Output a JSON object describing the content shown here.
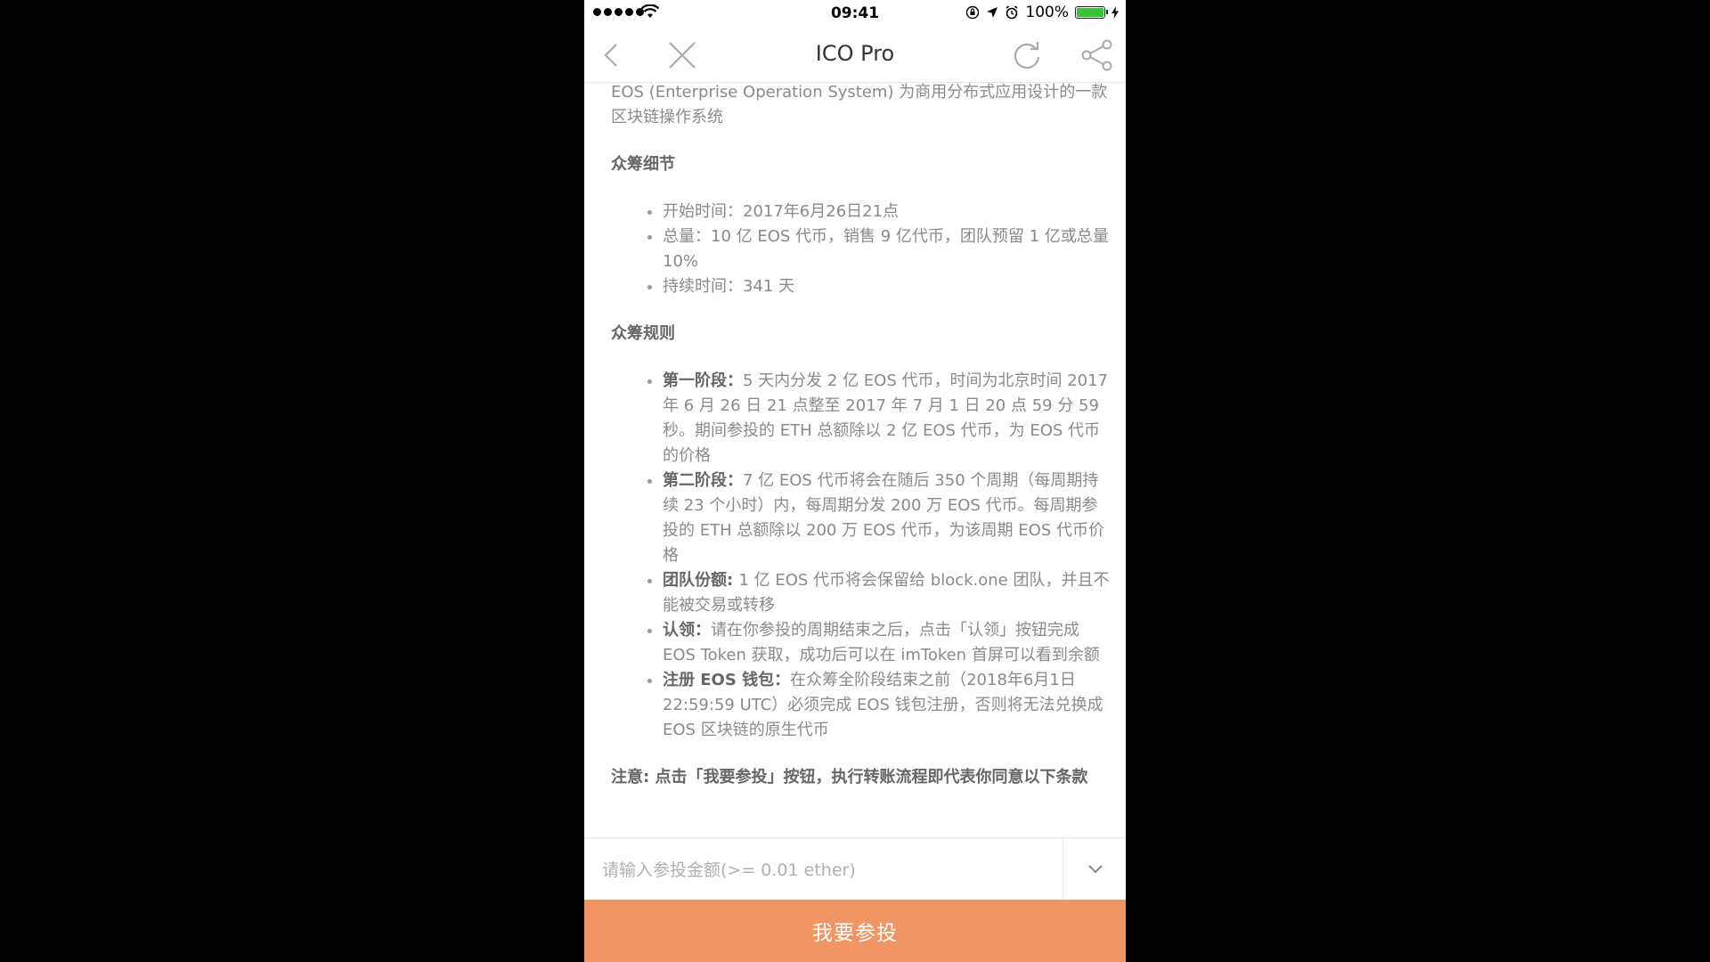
{
  "status_bar": {
    "time": "09:41",
    "battery_percent": "100%",
    "battery_level": 1.0
  },
  "nav": {
    "title": "ICO Pro",
    "icons": [
      "back-icon",
      "close-icon",
      "refresh-icon",
      "share-icon"
    ]
  },
  "content": {
    "intro": "EOS (Enterprise Operation System) 为商用分布式应用设计的一款区块链操作系统",
    "details": {
      "title": "众筹细节",
      "items": [
        "开始时间：2017年6月26日21点",
        "总量：10 亿 EOS 代币，销售 9 亿代币，团队预留 1 亿或总量 10%",
        "持续时间：341 天"
      ]
    },
    "rules": {
      "title": "众筹规则",
      "items": [
        {
          "label": "第一阶段：",
          "text": "5 天内分发 2 亿 EOS 代币，时间为北京时间 2017 年 6 月 26 日 21 点整至 2017 年 7 月 1 日 20 点 59 分 59 秒。期间参投的 ETH 总额除以 2 亿 EOS 代币，为 EOS 代币的价格"
        },
        {
          "label": "第二阶段：",
          "text": "7 亿 EOS 代币将会在随后 350 个周期（每周期持续 23 个小时）内，每周期分发 200 万 EOS 代币。每周期参投的 ETH 总额除以 200 万 EOS 代币，为该周期 EOS 代币价格"
        },
        {
          "label": "团队份额: ",
          "text": "1 亿 EOS 代币将会保留给 block.one 团队，并且不能被交易或转移"
        },
        {
          "label": "认领：",
          "text": "请在你参投的周期结束之后，点击「认领」按钮完成 EOS Token 获取，成功后可以在 imToken 首屏可以看到余额"
        },
        {
          "label": "注册 EOS 钱包：",
          "text": "在众筹全阶段结束之前（2018年6月1日 22:59:59 UTC）必须完成 EOS 钱包注册，否则将无法兑换成 EOS 区块链的原生代币"
        }
      ]
    },
    "notice": "注意: 点击「我要参投」按钮，执行转账流程即代表你同意以下条款"
  },
  "input": {
    "placeholder": "请输入参投金额(>= 0.01 ether)",
    "value": ""
  },
  "button": {
    "label": "我要参投"
  },
  "colors": {
    "button_bg": "#f09564",
    "battery": "#39c339",
    "text": "#8a8a8a"
  }
}
